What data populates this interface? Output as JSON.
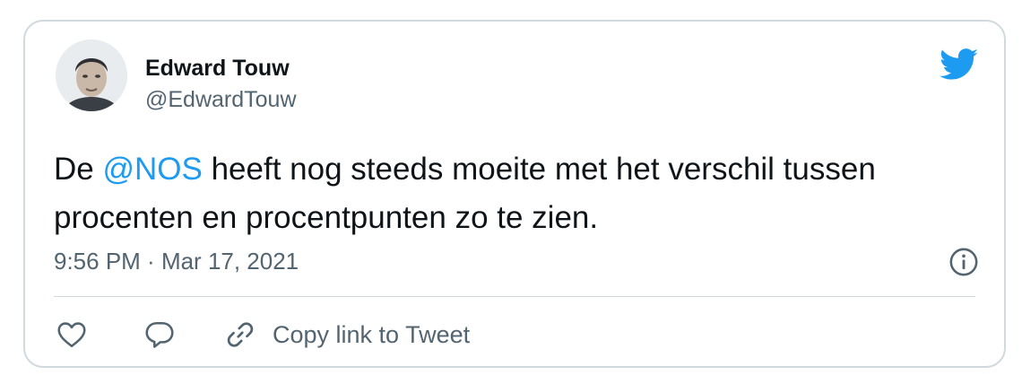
{
  "author": {
    "name": "Edward Touw",
    "handle": "@EdwardTouw"
  },
  "icons": {
    "brand": "twitter-bird-icon",
    "info": "info-icon",
    "like": "heart-icon",
    "reply": "speech-bubble-icon",
    "copy_link": "link-icon"
  },
  "tweet": {
    "text_prefix": "De ",
    "mention": "@NOS",
    "text_suffix": " heeft nog steeds moeite met het verschil tussen procenten en procentpunten zo te zien."
  },
  "meta": {
    "time": "9:56 PM",
    "separator": " · ",
    "date": "Mar 17, 2021"
  },
  "actions": {
    "copy_link_label": "Copy link to Tweet"
  },
  "colors": {
    "accent": "#1d9bf0",
    "secondary_text": "#536471",
    "border": "#cfd9de"
  }
}
